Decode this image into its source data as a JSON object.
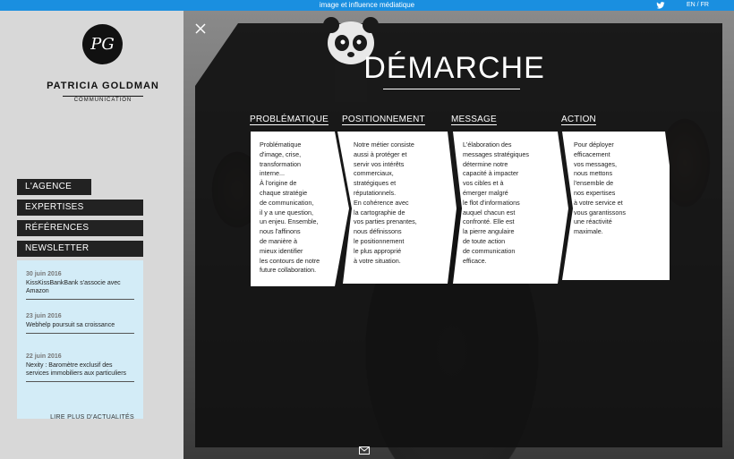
{
  "topbar": {
    "tagline": "image et influence médiatique",
    "twitter_icon": "twitter-icon",
    "lang_en": "EN",
    "lang_sep": " / ",
    "lang_fr": "FR"
  },
  "logo": {
    "monogram": "PG",
    "name": "PATRICIA GOLDMAN",
    "subtitle": "COMMUNICATION"
  },
  "nav": [
    {
      "label": "L'AGENCE"
    },
    {
      "label": "EXPERTISES"
    },
    {
      "label": "RÉFÉRENCES"
    },
    {
      "label": "NEWSLETTER"
    }
  ],
  "news": {
    "items": [
      {
        "date": "30 juin 2016",
        "title": "KissKissBankBank s'associe avec Amazon"
      },
      {
        "date": "23 juin 2016",
        "title": "Webhelp poursuit sa croissance"
      },
      {
        "date": "22 juin 2016",
        "title": "Nexity : Baromètre exclusif des services immobiliers aux particuliers"
      }
    ],
    "more_label": "LIRE PLUS D'ACTUALITÉS"
  },
  "modal": {
    "close_icon": "close-icon",
    "title": "DÉMARCHE",
    "columns": [
      {
        "heading": "PROBLÉMATIQUE",
        "lines": [
          "Problématique",
          "d'image, crise,",
          "transformation",
          "interne...",
          "À l'origine de",
          "chaque stratégie",
          "de communication,",
          "il y a une question,",
          "un enjeu. Ensemble,",
          "nous l'affinons",
          "de manière à",
          "mieux identifier",
          "les contours de notre",
          "future collaboration."
        ]
      },
      {
        "heading": "POSITIONNEMENT",
        "lines": [
          "Notre métier consiste",
          "aussi à protéger et",
          "servir vos intérêts",
          "commerciaux,",
          "stratégiques et",
          "réputationnels.",
          "En cohérence avec",
          "la cartographie de",
          "vos parties prenantes,",
          "nous définissons",
          "le positionnement",
          "le plus approprié",
          "à votre situation."
        ]
      },
      {
        "heading": "MESSAGE",
        "lines": [
          "L'élaboration des",
          "messages stratégiques",
          "détermine notre",
          "capacité à impacter",
          "vos cibles et à",
          "émerger malgré",
          "le flot d'informations",
          "auquel chacun est",
          "confronté. Elle est",
          "la pierre angulaire",
          "de toute action",
          "de communication",
          "efficace."
        ]
      },
      {
        "heading": "ACTION",
        "lines": [
          "Pour déployer",
          "efficacement",
          "vos messages,",
          "nous mettons",
          "l'ensemble de",
          "nos expertises",
          "à votre service et",
          "vous garantissons",
          "une réactivité",
          "maximale."
        ]
      }
    ]
  },
  "footer": {
    "mail_icon": "mail-icon"
  }
}
